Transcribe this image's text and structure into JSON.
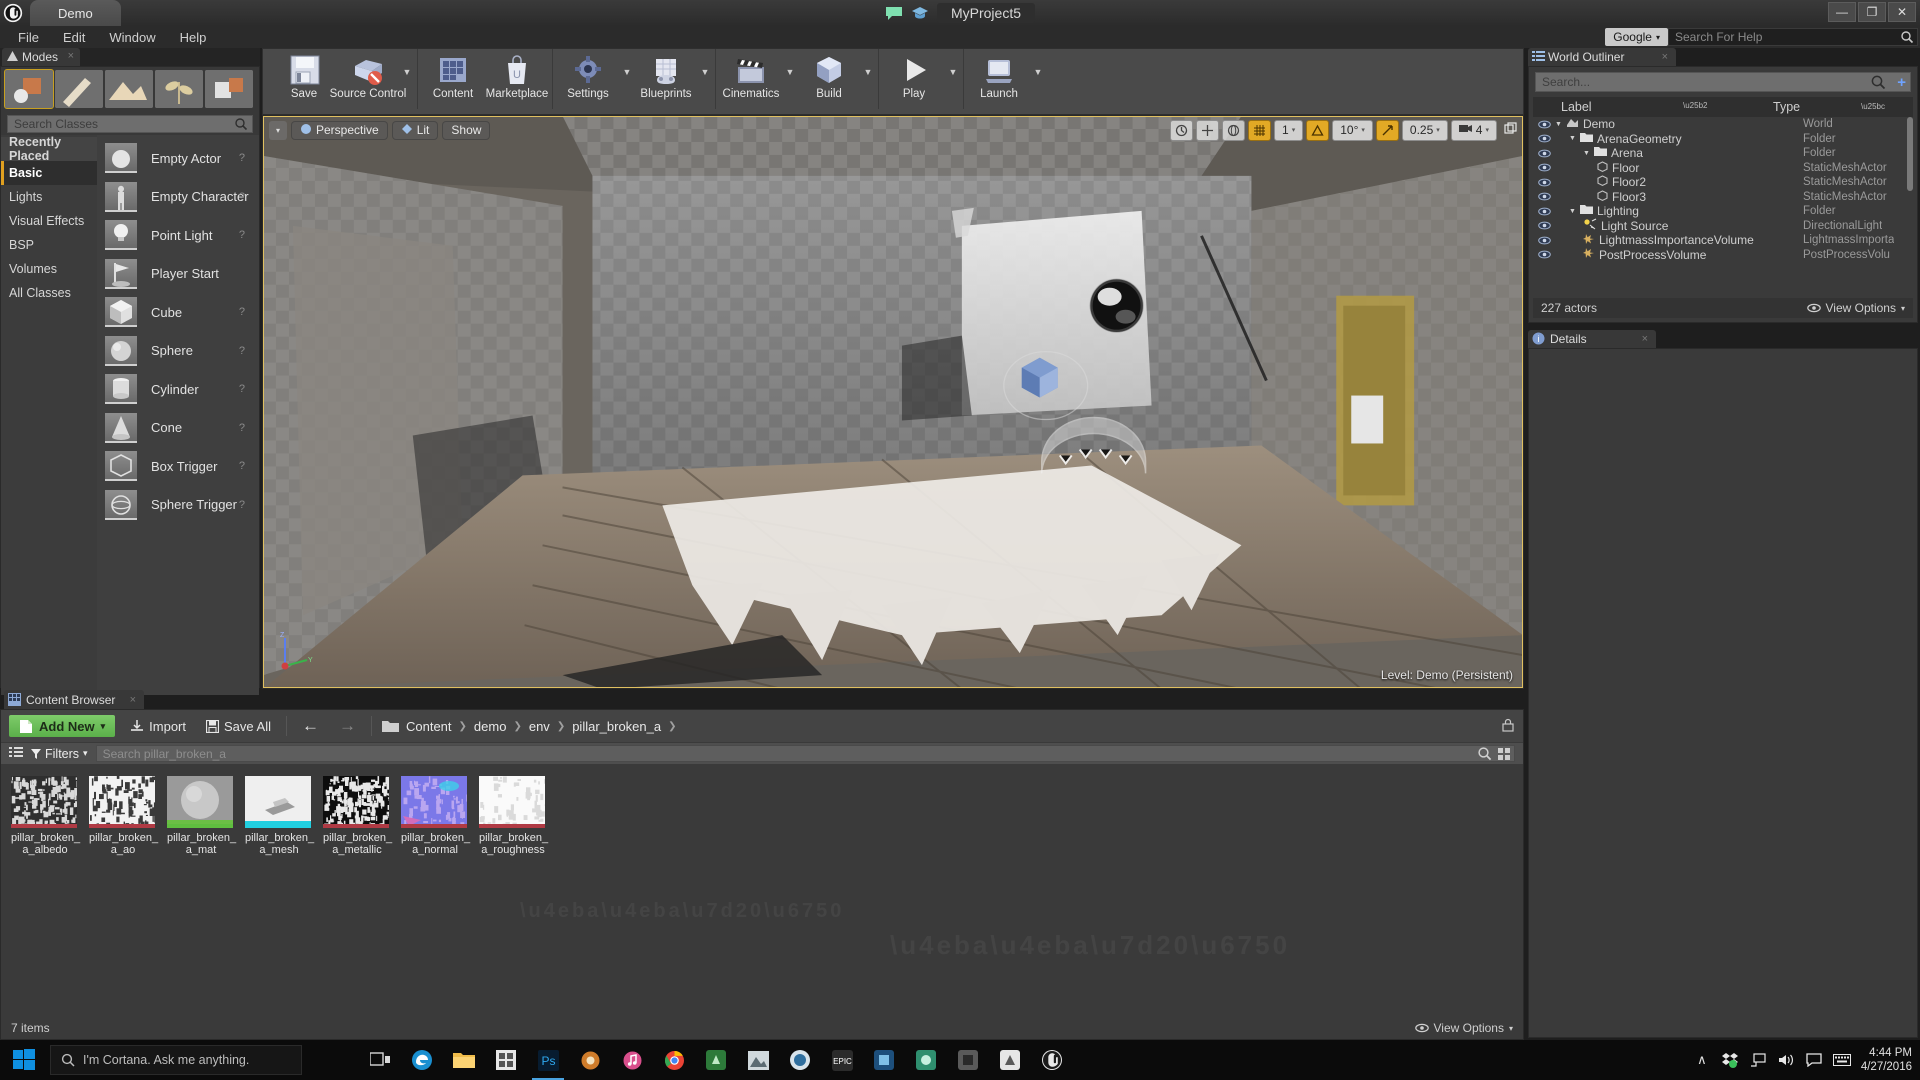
{
  "window": {
    "project_tab": "Demo",
    "title": "MyProject5",
    "minimize": "—",
    "maximize": "❐",
    "close": "✕"
  },
  "menu": {
    "items": [
      "File",
      "Edit",
      "Window",
      "Help"
    ],
    "search_engine": "Google",
    "help_placeholder": "Search For Help"
  },
  "modes": {
    "tab_label": "Modes",
    "close": "×",
    "mode_icons": [
      "place-mode-icon",
      "paint-mode-icon",
      "landscape-mode-icon",
      "foliage-mode-icon",
      "geometry-edit-mode-icon"
    ],
    "search_placeholder": "Search Classes",
    "categories": [
      {
        "label": "Recently Placed",
        "state": "hl"
      },
      {
        "label": "Basic",
        "state": "active"
      },
      {
        "label": "Lights",
        "state": ""
      },
      {
        "label": "Visual Effects",
        "state": ""
      },
      {
        "label": "BSP",
        "state": ""
      },
      {
        "label": "Volumes",
        "state": ""
      },
      {
        "label": "All Classes",
        "state": ""
      }
    ],
    "placeables": [
      {
        "label": "Empty Actor",
        "q": "?"
      },
      {
        "label": "Empty Character",
        "q": "?"
      },
      {
        "label": "Point Light",
        "q": "?"
      },
      {
        "label": "Player Start",
        "q": ""
      },
      {
        "label": "Cube",
        "q": "?"
      },
      {
        "label": "Sphere",
        "q": "?"
      },
      {
        "label": "Cylinder",
        "q": "?"
      },
      {
        "label": "Cone",
        "q": "?"
      },
      {
        "label": "Box Trigger",
        "q": "?"
      },
      {
        "label": "Sphere Trigger",
        "q": "?"
      }
    ]
  },
  "toolbar": {
    "buttons": [
      {
        "label": "Save",
        "icon": "floppy-disk-icon",
        "caret": false
      },
      {
        "label": "Source Control",
        "icon": "source-control-icon",
        "caret": true
      },
      {
        "label": "Content",
        "icon": "content-grid-icon",
        "caret": false
      },
      {
        "label": "Marketplace",
        "icon": "marketplace-bag-icon",
        "caret": false
      },
      {
        "label": "Settings",
        "icon": "settings-gear-icon",
        "caret": true
      },
      {
        "label": "Blueprints",
        "icon": "blueprints-icon",
        "caret": true
      },
      {
        "label": "Cinematics",
        "icon": "clapperboard-icon",
        "caret": true
      },
      {
        "label": "Build",
        "icon": "build-cube-icon",
        "caret": true
      },
      {
        "label": "Play",
        "icon": "play-triangle-icon",
        "caret": true
      },
      {
        "label": "Launch",
        "icon": "launch-device-icon",
        "caret": true
      }
    ]
  },
  "viewport": {
    "view_caret": "▾",
    "perspective": "Perspective",
    "lit": "Lit",
    "show": "Show",
    "right_controls": [
      {
        "name": "camera-speed-icon",
        "type": "icon",
        "value": "",
        "on": false
      },
      {
        "name": "transform-translate-icon",
        "type": "icon",
        "value": "",
        "on": false
      },
      {
        "name": "world-coords-icon",
        "type": "icon",
        "value": "",
        "on": false
      },
      {
        "name": "grid-snap-icon",
        "type": "icon",
        "value": "",
        "on": true
      },
      {
        "name": "grid-snap-value",
        "type": "num",
        "value": "1",
        "on": false
      },
      {
        "name": "angle-snap-icon",
        "type": "icon",
        "value": "",
        "on": true
      },
      {
        "name": "angle-snap-value",
        "type": "num",
        "value": "10°",
        "on": false
      },
      {
        "name": "scale-snap-icon",
        "type": "icon",
        "value": "",
        "on": true
      },
      {
        "name": "scale-snap-value",
        "type": "num",
        "value": "0.25",
        "on": false
      },
      {
        "name": "camera-speed-value",
        "type": "num",
        "value": "4",
        "on": false
      },
      {
        "name": "maximize-viewport-icon",
        "type": "plain",
        "value": "",
        "on": false
      }
    ],
    "level_label": "Level:",
    "level_name": "Demo (Persistent)"
  },
  "outliner": {
    "tab_label": "World Outliner",
    "close": "×",
    "search_placeholder": "Search...",
    "col_label": "Label",
    "col_type": "Type",
    "rows": [
      {
        "label": "Demo",
        "type": "World",
        "indent": 0,
        "icon": "world-icon",
        "arrow": true
      },
      {
        "label": "ArenaGeometry",
        "type": "Folder",
        "indent": 1,
        "icon": "folder-icon",
        "arrow": true
      },
      {
        "label": "Arena",
        "type": "Folder",
        "indent": 2,
        "icon": "folder-icon",
        "arrow": true
      },
      {
        "label": "Floor",
        "type": "StaticMeshActor",
        "indent": 3,
        "icon": "mesh-icon",
        "arrow": false
      },
      {
        "label": "Floor2",
        "type": "StaticMeshActor",
        "indent": 3,
        "icon": "mesh-icon",
        "arrow": false
      },
      {
        "label": "Floor3",
        "type": "StaticMeshActor",
        "indent": 3,
        "icon": "mesh-icon",
        "arrow": false
      },
      {
        "label": "Lighting",
        "type": "Folder",
        "indent": 1,
        "icon": "folder-icon",
        "arrow": true
      },
      {
        "label": "Light Source",
        "type": "DirectionalLight",
        "indent": 2,
        "icon": "light-icon",
        "arrow": false
      },
      {
        "label": "LightmassImportanceVolume",
        "type": "LightmassImporta",
        "indent": 2,
        "icon": "volume-icon",
        "arrow": false
      },
      {
        "label": "PostProcessVolume",
        "type": "PostProcessVolu",
        "indent": 2,
        "icon": "volume-icon",
        "arrow": false
      }
    ],
    "actor_count": "227 actors",
    "view_options": "View Options"
  },
  "details": {
    "tab_label": "Details",
    "close": "×"
  },
  "content_browser": {
    "tab_label": "Content Browser",
    "close": "×",
    "add_new": "Add New",
    "add_new_caret": "▾",
    "import": "Import",
    "save_all": "Save All",
    "back_arrow": "←",
    "fwd_arrow": "→",
    "breadcrumb": [
      "Content",
      "demo",
      "env",
      "pillar_broken_a"
    ],
    "breadcrumb_sep": "❯",
    "filters": "Filters",
    "filters_caret": "▾",
    "search_placeholder": "Search pillar_broken_a",
    "assets": [
      {
        "name": "pillar_broken_a_albedo",
        "line1": "pillar_broken_",
        "line2": "a_albedo",
        "accent": "#b03a44",
        "kind": "texture-dark"
      },
      {
        "name": "pillar_broken_a_ao",
        "line1": "pillar_broken_",
        "line2": "a_ao",
        "accent": "#b03a44",
        "kind": "texture-light"
      },
      {
        "name": "pillar_broken_a_mat",
        "line1": "pillar_broken_",
        "line2": "a_mat",
        "accent": "#5fbe3f",
        "kind": "material"
      },
      {
        "name": "pillar_broken_a_mesh",
        "line1": "pillar_broken_",
        "line2": "a_mesh",
        "accent": "#21cfe0",
        "kind": "mesh"
      },
      {
        "name": "pillar_broken_a_metallic",
        "line1": "pillar_broken_",
        "line2": "a_metallic",
        "accent": "#b03a44",
        "kind": "texture-black"
      },
      {
        "name": "pillar_broken_a_normal",
        "line1": "pillar_broken_",
        "line2": "a_normal",
        "accent": "#b03a44",
        "kind": "texture-normal"
      },
      {
        "name": "pillar_broken_a_roughness",
        "line1": "pillar_broken_",
        "line2": "a_roughness",
        "accent": "#b03a44",
        "kind": "texture-white"
      }
    ],
    "item_count": "7 items",
    "view_options": "View Options"
  },
  "taskbar": {
    "cortana_text": "I'm Cortana. Ask me anything.",
    "apps": [
      "task-view-icon",
      "edge-icon",
      "file-explorer-icon",
      "store-icon",
      "photoshop-icon",
      "app-orange-icon",
      "itunes-icon",
      "chrome-icon",
      "app-green-icon",
      "app-mountain-icon",
      "blue-circle-icon",
      "epic-launcher-icon",
      "app-blue2-icon",
      "app-teal-icon",
      "app-gray-icon",
      "app-white-icon",
      "unreal-editor-icon"
    ],
    "tray_icons": [
      "chevron-up-icon",
      "dropbox-icon",
      "network-icon",
      "volume-icon",
      "action-center-icon",
      "keyboard-icon"
    ],
    "time": "4:44 PM",
    "date": "4/27/2016"
  },
  "colors": {
    "accent_orange": "#e2a925",
    "green_addnew": "#5bb04a",
    "panel_bg": "#3a3a3a"
  }
}
